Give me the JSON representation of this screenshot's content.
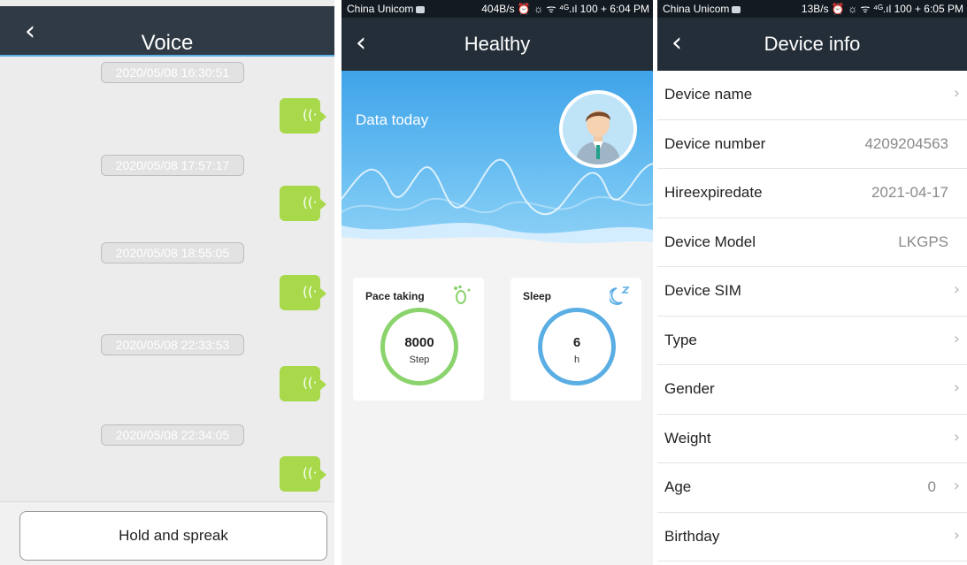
{
  "voice": {
    "title": "Voice",
    "back_icon": "‹",
    "messages": [
      {
        "timestamp": "2020/05/08 16:30:51"
      },
      {
        "timestamp": "2020/05/08 17:57:17"
      },
      {
        "timestamp": "2020/05/08 18:55:05"
      },
      {
        "timestamp": "2020/05/08 22:33:53"
      },
      {
        "timestamp": "2020/05/08 22:34:05"
      }
    ],
    "voice_icon_glyph": "((·",
    "hold_button": "Hold and spreak",
    "colors": {
      "header": "#2f3a44",
      "bubble": "#a7d94a"
    }
  },
  "healthy": {
    "status": {
      "carrier": "China Unicom",
      "right": "404B/s ⏰ ☼ ᯤ ⁴ᴳ.ıl 100 + 6:04 PM"
    },
    "title": "Healthy",
    "back_icon": "‹",
    "hero_label": "Data today",
    "cards": [
      {
        "title": "Pace taking",
        "value": "8000",
        "unit": "Step",
        "icon": "footprints-icon",
        "ring_color": "#8bd36c"
      },
      {
        "title": "Sleep",
        "value": "6",
        "unit": "h",
        "icon": "moon-sleep-icon",
        "ring_color": "#5aaee4"
      }
    ],
    "colors": {
      "hero_top": "#3fa3e9",
      "hero_bottom": "#8fd2f6"
    }
  },
  "device_info": {
    "status": {
      "carrier": "China Unicom",
      "right": "13B/s ⏰ ☼ ᯤ ⁴ᴳ.ıl 100 + 6:05 PM"
    },
    "title": "Device info",
    "back_icon": "‹",
    "chevron": "›",
    "rows": [
      {
        "label": "Device name",
        "value": "",
        "chevron": true
      },
      {
        "label": "Device number",
        "value": "4209204563",
        "chevron": false
      },
      {
        "label": "Hireexpiredate",
        "value": "2021-04-17",
        "chevron": false
      },
      {
        "label": "Device Model",
        "value": "LKGPS",
        "chevron": false
      },
      {
        "label": "Device SIM",
        "value": "",
        "chevron": true
      },
      {
        "label": "Type",
        "value": "",
        "chevron": true
      },
      {
        "label": "Gender",
        "value": "",
        "chevron": true
      },
      {
        "label": "Weight",
        "value": "",
        "chevron": true
      },
      {
        "label": "Age",
        "value": "0",
        "chevron": true
      },
      {
        "label": "Birthday",
        "value": "",
        "chevron": true
      }
    ]
  }
}
